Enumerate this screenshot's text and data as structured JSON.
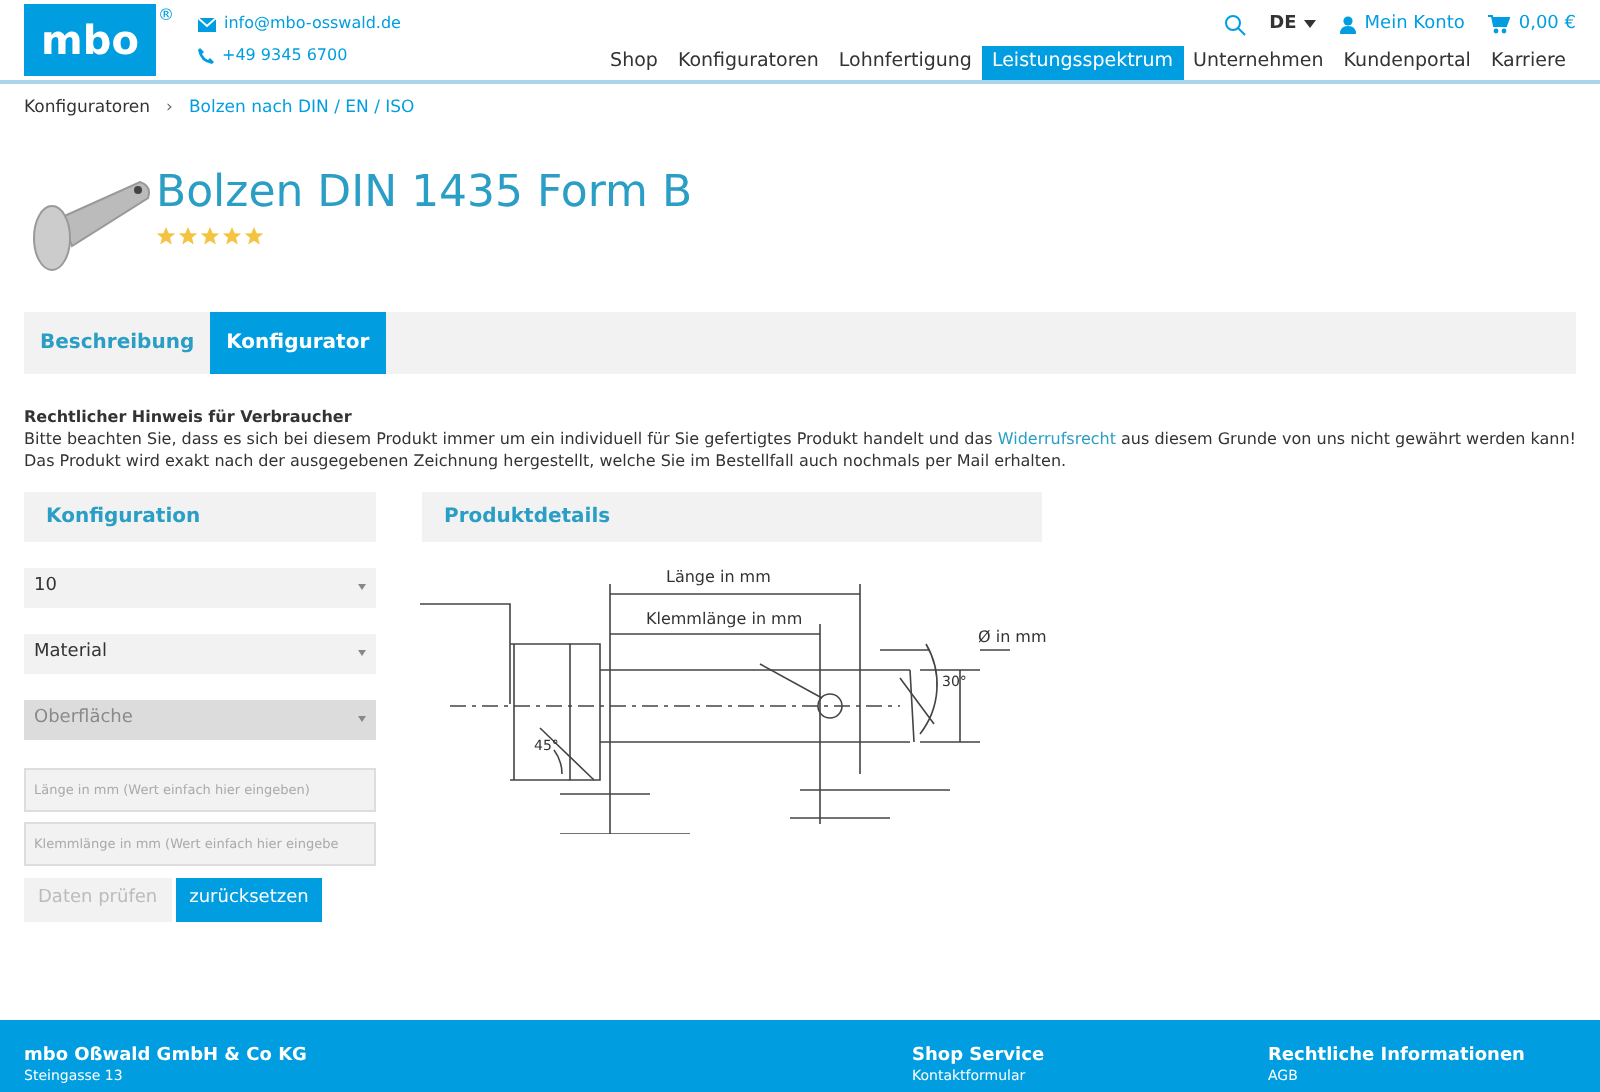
{
  "header": {
    "logo": "mbo",
    "registered": "®",
    "email": "info@mbo-osswald.de",
    "phone": "+49 9345 6700",
    "language": "DE",
    "account": "Mein Konto",
    "cart": "0,00 €"
  },
  "nav": [
    {
      "label": "Shop",
      "selected": false
    },
    {
      "label": "Konfiguratoren",
      "selected": false
    },
    {
      "label": "Lohnfertigung",
      "selected": false
    },
    {
      "label": "Leistungsspektrum",
      "selected": true
    },
    {
      "label": "Unternehmen",
      "selected": false
    },
    {
      "label": "Kundenportal",
      "selected": false
    },
    {
      "label": "Karriere",
      "selected": false
    }
  ],
  "breadcrumb_separator": "›",
  "breadcrumb": [
    {
      "label": "Konfiguratoren",
      "selected": false
    },
    {
      "label": "Bolzen nach DIN / EN / ISO",
      "selected": true
    }
  ],
  "product": {
    "title": "Bolzen DIN 1435 Form B",
    "stars": 5
  },
  "tabs": [
    {
      "label": "Beschreibung",
      "selected": false
    },
    {
      "label": "Konfigurator",
      "selected": true
    }
  ],
  "notice": {
    "heading": "Rechtlicher Hinweis für Verbraucher",
    "text_before": "Bitte beachten Sie, dass es sich bei diesem Produkt immer um ein individuell für Sie gefertigtes Produkt handelt und das",
    "link": "Widerrufsrecht",
    "text_after": "aus diesem Grunde von uns nicht gewährt werden kann! Das Produkt wird exakt nach der ausgegebenen Zeichnung hergestellt, welche Sie im Bestellfall auch nochmals per Mail erhalten."
  },
  "configuration": {
    "title": "Konfiguration",
    "selects": [
      {
        "value": "10",
        "disabled": false
      },
      {
        "value": "Material",
        "disabled": false
      },
      {
        "value": "Oberfläche",
        "disabled": true
      }
    ],
    "inputs": [
      {
        "placeholder": "Länge in mm (Wert einfach hier eingeben)"
      },
      {
        "placeholder": "Klemmlänge in mm (Wert einfach hier eingebe"
      }
    ],
    "buttons": [
      {
        "label": "Daten prüfen",
        "disabled": true
      },
      {
        "label": "zurücksetzen",
        "disabled": false
      }
    ]
  },
  "details": {
    "title": "Produktdetails",
    "labels": {
      "length": "Länge in mm",
      "clamp": "Klemmlänge in mm",
      "diameter": "Ø in mm",
      "angle_head": "45°",
      "angle_tip": "30°"
    }
  },
  "footer": {
    "columns": [
      {
        "title": "mbo Oßwald GmbH & Co KG",
        "line": "Steingasse 13"
      },
      {
        "title": "Shop Service",
        "line": "Kontaktformular"
      },
      {
        "title": "Rechtliche Informationen",
        "line": "AGB"
      }
    ]
  }
}
